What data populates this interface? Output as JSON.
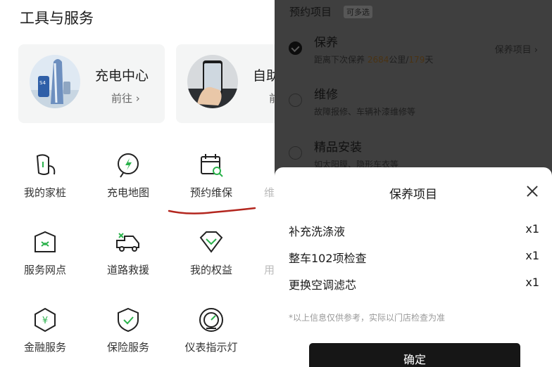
{
  "tools": {
    "section_title": "工具与服务",
    "cards": [
      {
        "title": "充电中心",
        "action": "前往 ›"
      },
      {
        "title": "自助",
        "action": "前"
      }
    ],
    "grid": [
      {
        "label": "我的家桩",
        "icon": "home-charger-icon"
      },
      {
        "label": "充电地图",
        "icon": "charging-map-icon"
      },
      {
        "label": "预约维保",
        "icon": "maintenance-calendar-icon"
      },
      {
        "label": "维",
        "icon": "partial-icon"
      },
      {
        "label": "服务网点",
        "icon": "service-outlet-icon"
      },
      {
        "label": "道路救援",
        "icon": "road-rescue-icon"
      },
      {
        "label": "我的权益",
        "icon": "benefits-icon"
      },
      {
        "label": "用",
        "icon": "partial-icon"
      },
      {
        "label": "金融服务",
        "icon": "finance-icon"
      },
      {
        "label": "保险服务",
        "icon": "insurance-icon"
      },
      {
        "label": "仪表指示灯",
        "icon": "dashboard-icon"
      }
    ]
  },
  "booking": {
    "header": "预约项目",
    "multi_tag": "可多选",
    "options": [
      {
        "title": "保养",
        "desc_prefix": "距离下次保养 ",
        "km": "2684",
        "desc_mid": "公里/",
        "days": "179",
        "desc_suffix": "天",
        "link": "保养项目 ›",
        "selected": true
      },
      {
        "title": "维修",
        "desc": "故障报修、车辆补漆维修等",
        "selected": false
      },
      {
        "title": "精品安装",
        "desc": "如太阳膜、隐形车衣等",
        "selected": false
      }
    ]
  },
  "sheet": {
    "title": "保养项目",
    "items": [
      {
        "name": "补充洗涤液",
        "qty": "x1"
      },
      {
        "name": "整车102项检查",
        "qty": "x1"
      },
      {
        "name": "更换空调滤芯",
        "qty": "x1"
      }
    ],
    "note": "*以上信息仅供参考，实际以门店检查为准",
    "confirm_label": "确定"
  },
  "colors": {
    "accent_green": "#2bb24c",
    "annotation_red": "#b3261e"
  }
}
